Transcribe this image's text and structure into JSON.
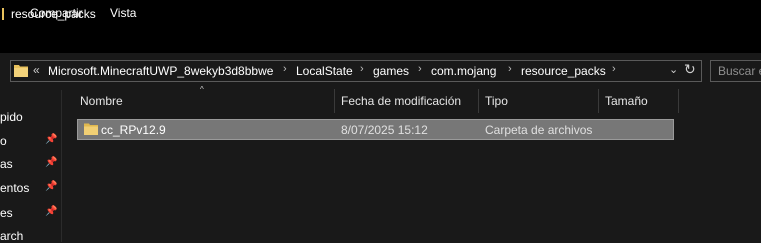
{
  "window": {
    "title": "resource_packs"
  },
  "ribbon": {
    "tabs": [
      "Compartir",
      "Vista"
    ]
  },
  "address_bar": {
    "overflow": "«",
    "crumbs": [
      "Microsoft.MinecraftUWP_8wekyb3d8bbwe",
      "LocalState",
      "games",
      "com.mojang",
      "resource_packs"
    ],
    "separator": "›",
    "dropdown": "⌄",
    "refresh": "↻"
  },
  "search": {
    "placeholder": "Buscar e"
  },
  "nav": {
    "items": [
      {
        "label": "pido",
        "pinned": false
      },
      {
        "label": "o",
        "pinned": true
      },
      {
        "label": "as",
        "pinned": true
      },
      {
        "label": "entos",
        "pinned": true
      },
      {
        "label": "es",
        "pinned": true
      },
      {
        "label": "arch",
        "pinned": false
      }
    ],
    "pin_glyph": "📌"
  },
  "columns": {
    "name": "Nombre",
    "modified": "Fecha de modificación",
    "type": "Tipo",
    "size": "Tamaño",
    "sort_arrow": "^"
  },
  "files": [
    {
      "name": "cc_RPv12.9",
      "modified": "8/07/2025 15:12",
      "type": "Carpeta de archivos",
      "size": "",
      "selected": true
    }
  ],
  "colors": {
    "folder": "#e8c15c",
    "selection": "#777777",
    "background": "#191919"
  }
}
